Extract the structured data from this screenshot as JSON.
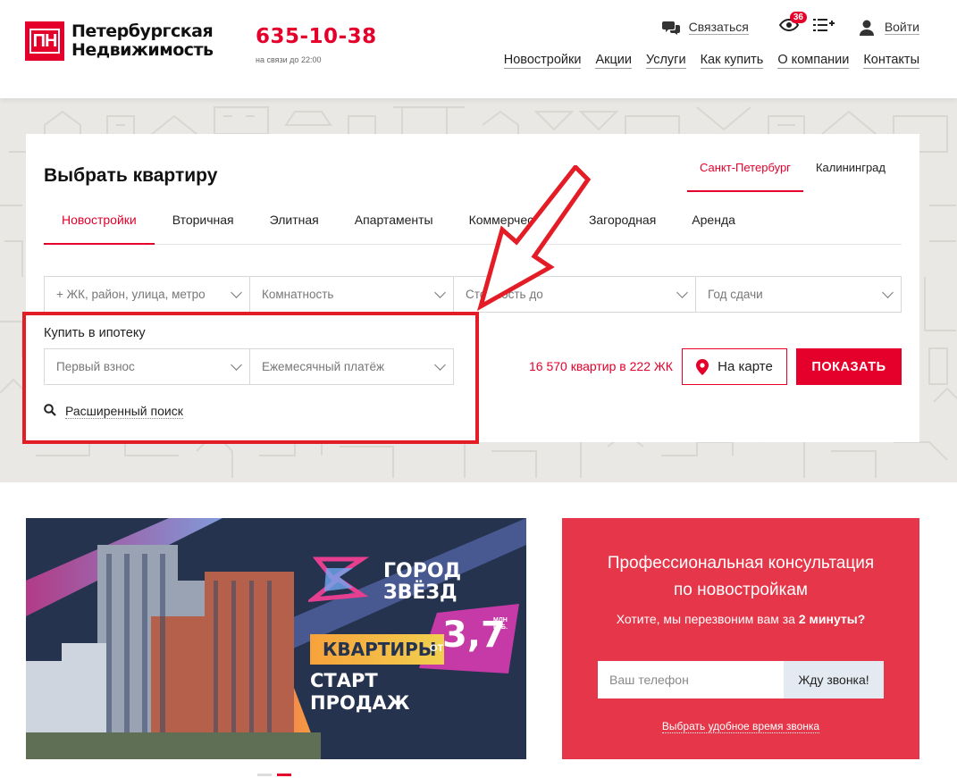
{
  "header": {
    "logo_text_line1": "Петербургская",
    "logo_text_line2": "Недвижимость",
    "logo_mark": "ПН",
    "phone": "635-10-38",
    "phone_hours": "на связи до 22:00",
    "contact_label": "Связаться",
    "viewed_count": "36",
    "login_label": "Войти",
    "nav": [
      "Новостройки",
      "Акции",
      "Услуги",
      "Как купить",
      "О компании",
      "Контакты"
    ]
  },
  "search": {
    "title": "Выбрать квартиру",
    "cities": [
      "Санкт-Петербург",
      "Калининград"
    ],
    "active_city": "Санкт-Петербург",
    "types": [
      "Новостройки",
      "Вторичная",
      "Элитная",
      "Апартаменты",
      "Коммерческая",
      "Загородная",
      "Аренда"
    ],
    "active_type": "Новостройки",
    "fields": [
      "+ ЖК, район, улица, метро",
      "Комнатность",
      "Стоимость до",
      "Год сдачи"
    ],
    "mortgage_label": "Купить в ипотеку",
    "mortgage_fields": [
      "Первый взнос",
      "Ежемесячный платёж"
    ],
    "advanced_label": "Расширенный поиск",
    "result_count": "16 570 квартир в 222 ЖК",
    "map_button": "На карте",
    "show_button": "ПОКАЗАТЬ"
  },
  "banner": {
    "logo_line1": "ГОРОД",
    "logo_line2": "ЗВЁЗД",
    "flats_label": "КВАРТИРЫ",
    "price_prefix": "ОТ",
    "price_value": "3,7",
    "price_unit_line1": "МЛН",
    "price_unit_line2": "РУБ.",
    "start_line1": "СТАРТ",
    "start_line2": "ПРОДАЖ"
  },
  "consult": {
    "title_line1": "Профессиональная консультация",
    "title_line2": "по новостройкам",
    "subtitle_prefix": "Хотите, мы перезвоним вам за",
    "subtitle_bold": "2 минуты?",
    "phone_placeholder": "Ваш телефон",
    "button_label": "Жду звонка!",
    "time_link": "Выбрать удобное время звонка"
  },
  "colors": {
    "brand_red": "#e4002b",
    "annotation_red": "#e31c25",
    "consult_bg": "#e6374a",
    "banner_bg": "#25334f"
  }
}
